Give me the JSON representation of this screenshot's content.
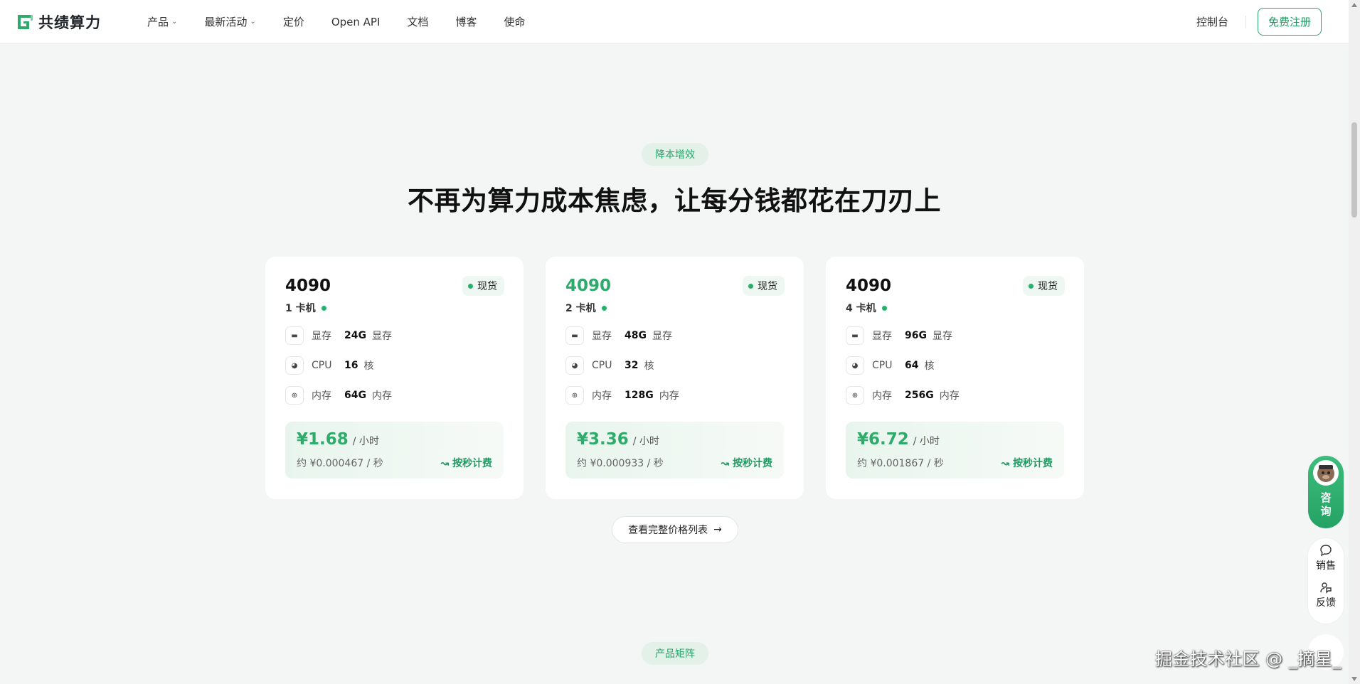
{
  "header": {
    "brand": "共绩算力",
    "nav": [
      {
        "label": "产品",
        "dropdown": true
      },
      {
        "label": "最新活动",
        "dropdown": true
      },
      {
        "label": "定价",
        "dropdown": false
      },
      {
        "label": "Open API",
        "dropdown": false
      },
      {
        "label": "文档",
        "dropdown": false
      },
      {
        "label": "博客",
        "dropdown": false
      },
      {
        "label": "使命",
        "dropdown": false
      }
    ],
    "console": "控制台",
    "signup": "免费注册"
  },
  "section": {
    "tag": "降本增效",
    "headline": "不再为算力成本焦虑，让每分钱都花在刀刃上",
    "cards": [
      {
        "title": "4090",
        "stock": "现货",
        "sub": "1 卡机",
        "vram_label": "显存",
        "vram": "24G",
        "vram_unit": "显存",
        "cpu_label": "CPU",
        "cpu": "16",
        "cpu_unit": "核",
        "mem_label": "内存",
        "mem": "64G",
        "mem_unit": "内存",
        "price": "¥1.68",
        "per": "/ 小时",
        "per_sec": "约 ¥0.000467 / 秒",
        "billing": "按秒计费"
      },
      {
        "title": "4090",
        "stock": "现货",
        "sub": "2 卡机",
        "vram_label": "显存",
        "vram": "48G",
        "vram_unit": "显存",
        "cpu_label": "CPU",
        "cpu": "32",
        "cpu_unit": "核",
        "mem_label": "内存",
        "mem": "128G",
        "mem_unit": "内存",
        "price": "¥3.36",
        "per": "/ 小时",
        "per_sec": "约 ¥0.000933 / 秒",
        "billing": "按秒计费"
      },
      {
        "title": "4090",
        "stock": "现货",
        "sub": "4 卡机",
        "vram_label": "显存",
        "vram": "96G",
        "vram_unit": "显存",
        "cpu_label": "CPU",
        "cpu": "64",
        "cpu_unit": "核",
        "mem_label": "内存",
        "mem": "256G",
        "mem_unit": "内存",
        "price": "¥6.72",
        "per": "/ 小时",
        "per_sec": "约 ¥0.001867 / 秒",
        "billing": "按秒计费"
      }
    ],
    "full_list": "查看完整价格列表"
  },
  "next_tag": "产品矩阵",
  "floating": {
    "consult": "咨询",
    "sales": "销售",
    "feedback": "反馈"
  },
  "watermark": "掘金技术社区 @ _摘星_",
  "colors": {
    "accent": "#2eaa6b",
    "tag_bg": "#e3f1e8"
  }
}
